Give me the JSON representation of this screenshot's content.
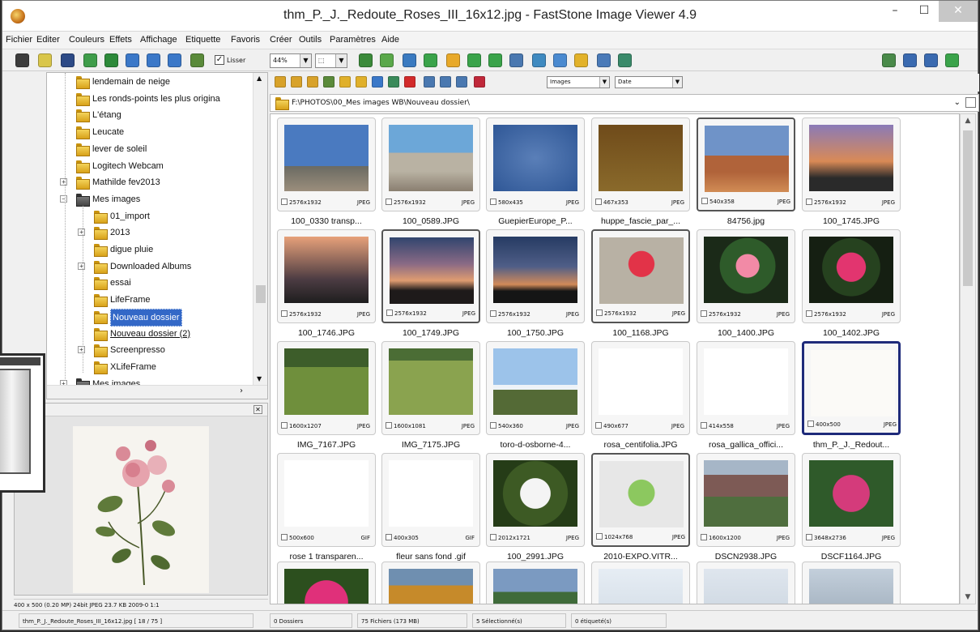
{
  "window": {
    "title": "thm_P._J._Redoute_Roses_III_16x12.jpg  -  FastStone Image Viewer 4.9",
    "min_label": "–",
    "max_label": "☐",
    "close_label": "✕"
  },
  "menu": [
    "Fichier",
    "Editer",
    "Couleurs",
    "Effets",
    "Affichage",
    "Etiquette",
    "Favoris",
    "Créer",
    "Outils",
    "Paramètres",
    "Aide"
  ],
  "toolbar": {
    "lisser_label": "Lisser",
    "zoom_value": "44%",
    "icon_colors": [
      "#3c3c3c",
      "#d9c64a",
      "#2d4a86",
      "#3f9d4a",
      "#2d8a3a",
      "#3b78c8",
      "#3b78c8",
      "#3b78c8",
      "#5a8a3a",
      "#3b8a3a",
      "#5aa84a",
      "#3a7ac0",
      "#3aa34a",
      "#e8a92a",
      "#3aa34a",
      "#3aa34a",
      "#4a78b0",
      "#3f8ac0",
      "#4a8ad0",
      "#e2b22a",
      "#4a7ab8",
      "#3a8a6a"
    ],
    "right_icons": [
      "#4a8a4a",
      "#3a6ab0",
      "#3a6ab0",
      "#3aa34a"
    ]
  },
  "tree": {
    "items": [
      {
        "label": "lendemain de neige"
      },
      {
        "label": "Les ronds-points les plus origina"
      },
      {
        "label": "L'étang"
      },
      {
        "label": "Leucate"
      },
      {
        "label": "lever de soleil"
      },
      {
        "label": "Logitech Webcam"
      },
      {
        "label": "Mathilde fev2013"
      },
      {
        "label": "Mes images"
      },
      {
        "label": "01_import"
      },
      {
        "label": "2013"
      },
      {
        "label": "digue pluie"
      },
      {
        "label": "Downloaded Albums"
      },
      {
        "label": "essai"
      },
      {
        "label": "LifeFrame"
      },
      {
        "label": "Nouveau dossier"
      },
      {
        "label": "Nouveau dossier (2)"
      },
      {
        "label": "Screenpresso"
      },
      {
        "label": "XLifeFrame"
      },
      {
        "label": "Mes images"
      }
    ]
  },
  "browser": {
    "filter_value": "Images",
    "sort_value": "Date",
    "path": "F:\\PHOTOS\\00_Mes images WB\\Nouveau dossier\\"
  },
  "thumbnails": [
    {
      "size": "2576x1932",
      "fmt": "JPEG",
      "name": "100_0330 transp...",
      "style": "p-sky1"
    },
    {
      "size": "2576x1932",
      "fmt": "JPEG",
      "name": "100_0589.JPG",
      "style": "p-beach"
    },
    {
      "size": "580x435",
      "fmt": "JPEG",
      "name": "GuepierEurope_P...",
      "style": "p-bird"
    },
    {
      "size": "467x353",
      "fmt": "JPEG",
      "name": "huppe_fascie_par_...",
      "style": "p-hoopoe"
    },
    {
      "size": "540x358",
      "fmt": "JPEG",
      "name": "84756.jpg",
      "style": "p-desert"
    },
    {
      "size": "2576x1932",
      "fmt": "JPEG",
      "name": "100_1745.JPG",
      "style": "p-sunset1"
    },
    {
      "size": "2576x1932",
      "fmt": "JPEG",
      "name": "100_1746.JPG",
      "style": "p-sunset2"
    },
    {
      "size": "2576x1932",
      "fmt": "JPEG",
      "name": "100_1749.JPG",
      "style": "p-dusk"
    },
    {
      "size": "2576x1932",
      "fmt": "JPEG",
      "name": "100_1750.JPG",
      "style": "p-dusk2"
    },
    {
      "size": "2576x1932",
      "fmt": "JPEG",
      "name": "100_1168.JPG",
      "style": "p-rose1"
    },
    {
      "size": "2576x1932",
      "fmt": "JPEG",
      "name": "100_1400.JPG",
      "style": "p-rose2"
    },
    {
      "size": "2576x1932",
      "fmt": "JPEG",
      "name": "100_1402.JPG",
      "style": "p-rose3"
    },
    {
      "size": "1600x1207",
      "fmt": "JPEG",
      "name": "IMG_7167.JPG",
      "style": "p-cow1"
    },
    {
      "size": "1600x1081",
      "fmt": "JPEG",
      "name": "IMG_7175.JPG",
      "style": "p-cow2"
    },
    {
      "size": "540x360",
      "fmt": "JPEG",
      "name": "toro-d-osborne-4...",
      "style": "p-bull"
    },
    {
      "size": "490x677",
      "fmt": "JPEG",
      "name": "rosa_centifolia.JPG",
      "style": "p-white"
    },
    {
      "size": "414x558",
      "fmt": "JPEG",
      "name": "rosa_gallica_offici...",
      "style": "p-white"
    },
    {
      "size": "400x500",
      "fmt": "JPEG",
      "name": "thm_P._J._Redout...",
      "style": "p-white2"
    },
    {
      "size": "500x600",
      "fmt": "GIF",
      "name": "rose 1 transparen...",
      "style": "p-white"
    },
    {
      "size": "400x305",
      "fmt": "GIF",
      "name": "fleur sans fond .gif",
      "style": "p-white"
    },
    {
      "size": "2012x1721",
      "fmt": "JPEG",
      "name": "100_2991.JPG",
      "style": "p-magnolia"
    },
    {
      "size": "1024x768",
      "fmt": "JPEG",
      "name": "2010-EXPO.VITR...",
      "style": "p-stained"
    },
    {
      "size": "1600x1200",
      "fmt": "JPEG",
      "name": "DSCN2938.JPG",
      "style": "p-crowd"
    },
    {
      "size": "3648x2736",
      "fmt": "JPEG",
      "name": "DSCF1164.JPG",
      "style": "p-pink"
    },
    {
      "style": "p-row5a"
    },
    {
      "style": "p-row5b"
    },
    {
      "style": "p-row5c"
    },
    {
      "style": "p-row5d"
    },
    {
      "style": "p-row5e"
    },
    {
      "style": "p-row5f"
    }
  ],
  "preview": {
    "info": "400 x 500 (0.20 MP)  24bit  JPEG  23.7 KB  2009-0  1:1"
  },
  "status": {
    "file": "thm_P._J._Redoute_Roses_III_16x12.jpg [ 18 / 75 ]",
    "dossiers": "0 Dossiers",
    "fichiers": "75 Fichiers (173 MB)",
    "selection": "5 Sélectionné(s)",
    "etiquette": "0 étiqueté(s)"
  }
}
